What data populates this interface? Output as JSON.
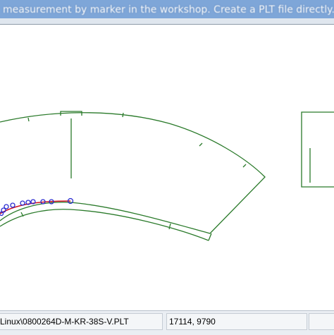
{
  "window": {
    "banner_text": "measurement by marker in the workshop. Create a PLT file directly. Before the projection, it must be optimized for cl"
  },
  "status": {
    "file_path": "Linux\\0800264D-M-KR-38S-V.PLT",
    "coordinates": "17114, 9790",
    "extra": ""
  },
  "colors": {
    "outline": "#2a7a2a",
    "fit_curve": "#d01020",
    "marker": "#2a2ad0"
  }
}
